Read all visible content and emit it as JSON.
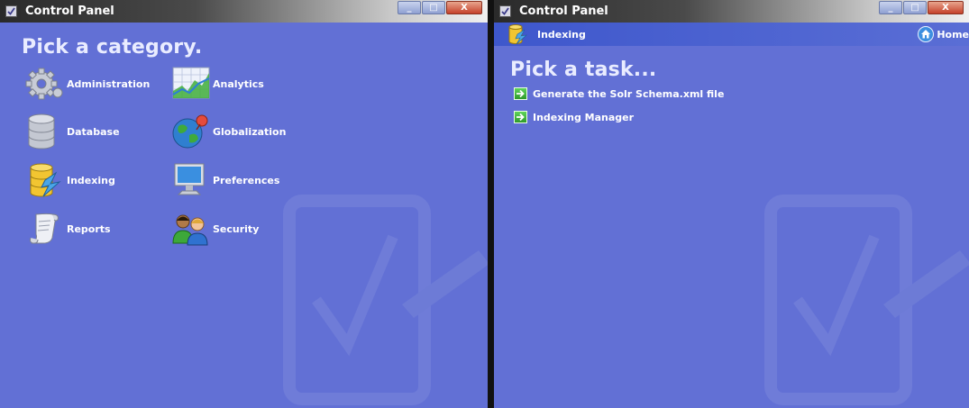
{
  "left_window": {
    "title": "Control Panel",
    "heading": "Pick a category.",
    "categories": [
      {
        "label": "Administration",
        "icon": "gear-icon"
      },
      {
        "label": "Analytics",
        "icon": "chart-icon"
      },
      {
        "label": "Database",
        "icon": "database-icon"
      },
      {
        "label": "Globalization",
        "icon": "globe-icon"
      },
      {
        "label": "Indexing",
        "icon": "indexing-icon"
      },
      {
        "label": "Preferences",
        "icon": "monitor-icon"
      },
      {
        "label": "Reports",
        "icon": "scroll-icon"
      },
      {
        "label": "Security",
        "icon": "users-icon"
      }
    ],
    "caption_buttons": {
      "minimize": "_",
      "maximize": "□",
      "close": "X"
    }
  },
  "right_window": {
    "title": "Control Panel",
    "breadcrumb": {
      "label": "Indexing",
      "home_label": "Home"
    },
    "heading": "Pick a task...",
    "tasks": [
      {
        "label": "Generate the Solr Schema.xml file"
      },
      {
        "label": "Indexing Manager"
      }
    ],
    "caption_buttons": {
      "minimize": "_",
      "maximize": "□",
      "close": "X"
    }
  },
  "colors": {
    "panel_background": "#6270d5",
    "heading_text": "#e9ecff",
    "breadcrumb_bar": "#3e57cc",
    "task_arrow": "#2e9a2a"
  }
}
